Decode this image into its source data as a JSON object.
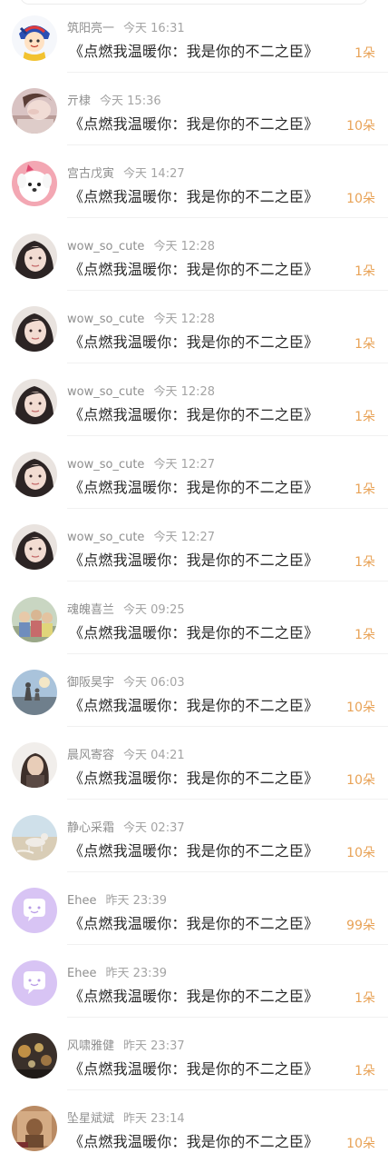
{
  "gift_list": {
    "items": [
      {
        "user": "筑阳亮一",
        "time": "今天 16:31",
        "gift": "《点燃我温暖你：我是你的不二之臣》",
        "count": "1朵",
        "avatar": "anime-avatar-icon"
      },
      {
        "user": "亓棣",
        "time": "今天 15:36",
        "gift": "《点燃我温暖你：我是你的不二之臣》",
        "count": "10朵",
        "avatar": "photo-avatar-icon"
      },
      {
        "user": "宫古戊寅",
        "time": "今天 14:27",
        "gift": "《点燃我温暖你：我是你的不二之臣》",
        "count": "10朵",
        "avatar": "puppy-avatar-icon"
      },
      {
        "user": "wow_so_cute",
        "time": "今天 12:28",
        "gift": "《点燃我温暖你：我是你的不二之臣》",
        "count": "1朵",
        "avatar": "girl-photo-avatar-icon"
      },
      {
        "user": "wow_so_cute",
        "time": "今天 12:28",
        "gift": "《点燃我温暖你：我是你的不二之臣》",
        "count": "1朵",
        "avatar": "girl-photo-avatar-icon"
      },
      {
        "user": "wow_so_cute",
        "time": "今天 12:28",
        "gift": "《点燃我温暖你：我是你的不二之臣》",
        "count": "1朵",
        "avatar": "girl-photo-avatar-icon"
      },
      {
        "user": "wow_so_cute",
        "time": "今天 12:27",
        "gift": "《点燃我温暖你：我是你的不二之臣》",
        "count": "1朵",
        "avatar": "girl-photo-avatar-icon"
      },
      {
        "user": "wow_so_cute",
        "time": "今天 12:27",
        "gift": "《点燃我温暖你：我是你的不二之臣》",
        "count": "1朵",
        "avatar": "girl-photo-avatar-icon"
      },
      {
        "user": "魂魄喜兰",
        "time": "今天 09:25",
        "gift": "《点燃我温暖你：我是你的不二之臣》",
        "count": "1朵",
        "avatar": "group-photo-avatar-icon"
      },
      {
        "user": "御阪昊宇",
        "time": "今天 06:03",
        "gift": "《点燃我温暖你：我是你的不二之臣》",
        "count": "10朵",
        "avatar": "beach-photo-avatar-icon"
      },
      {
        "user": "晨风寄容",
        "time": "今天 04:21",
        "gift": "《点燃我温暖你：我是你的不二之臣》",
        "count": "10朵",
        "avatar": "portrait-photo-avatar-icon"
      },
      {
        "user": "静心采霜",
        "time": "今天 02:37",
        "gift": "《点燃我温暖你：我是你的不二之臣》",
        "count": "10朵",
        "avatar": "dog-beach-avatar-icon"
      },
      {
        "user": "Ehee",
        "time": "昨天 23:39",
        "gift": "《点燃我温暖你：我是你的不二之臣》",
        "count": "99朵",
        "avatar": "chat-bubble-avatar-icon"
      },
      {
        "user": "Ehee",
        "time": "昨天 23:39",
        "gift": "《点燃我温暖你：我是你的不二之臣》",
        "count": "1朵",
        "avatar": "chat-bubble-avatar-icon"
      },
      {
        "user": "风啸雅健",
        "time": "昨天 23:37",
        "gift": "《点燃我温暖你：我是你的不二之臣》",
        "count": "1朵",
        "avatar": "night-lights-avatar-icon"
      },
      {
        "user": "坠星斌斌",
        "time": "昨天 23:14",
        "gift": "《点燃我温暖你：我是你的不二之臣》",
        "count": "10朵",
        "avatar": "vintage-photo-avatar-icon"
      }
    ]
  },
  "colors": {
    "count": "#e8a256",
    "username": "#8f8f8f",
    "gift_text": "#2a2a2a",
    "divider": "#f1f1f1",
    "chat_avatar_bg": "#d8c4f4"
  }
}
